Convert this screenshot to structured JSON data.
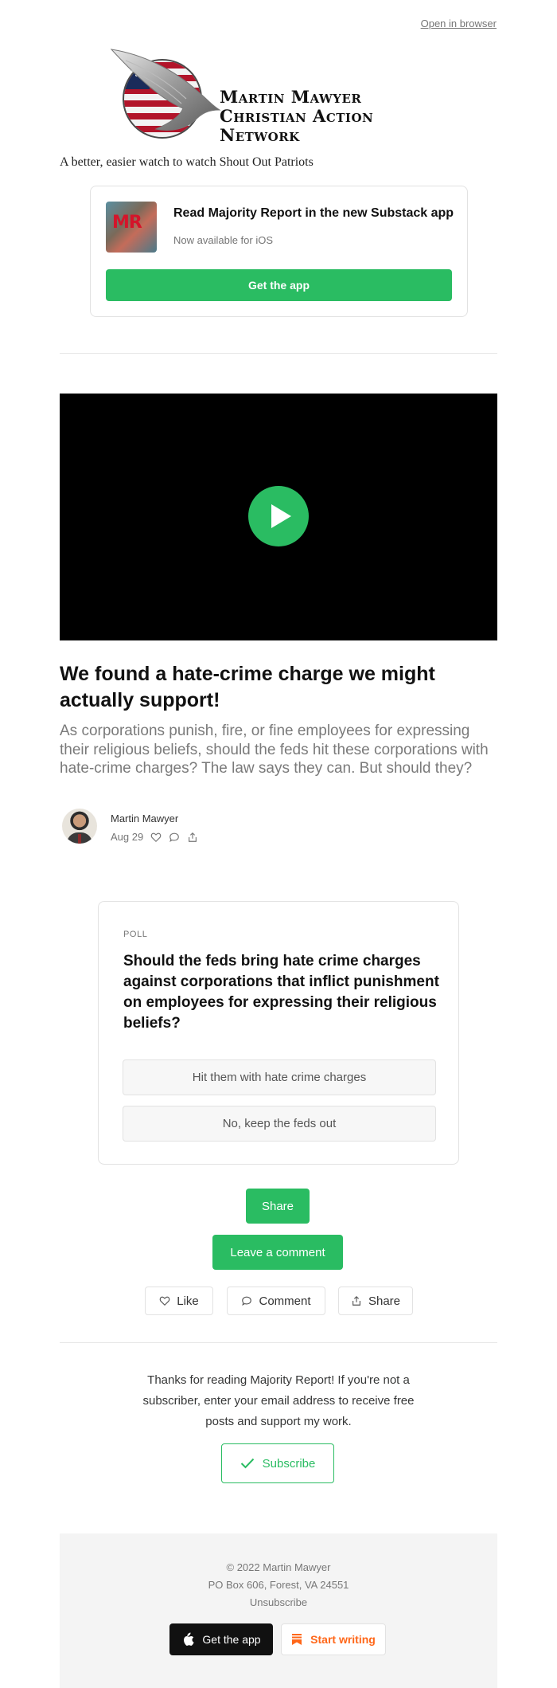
{
  "header": {
    "open_in_browser": "Open in browser",
    "logo_line1": "Martin Mawyer",
    "logo_line2": "Christian Action Network",
    "tagline": "A better, easier watch to watch Shout Out Patriots"
  },
  "app_promo": {
    "thumb_text": "MR",
    "title": "Read Majority Report in the new Substack app",
    "subtitle": "Now available for iOS",
    "button": "Get the app"
  },
  "video": {
    "play_icon": "play-icon"
  },
  "post": {
    "title": "We found a hate-crime charge we might actually support!",
    "subtitle": "As corporations punish, fire, or fine employees for expressing their religious beliefs, should the feds hit these corporations with hate-crime charges? The law says they can. But should they?",
    "author": "Martin Mawyer",
    "date": "Aug 29"
  },
  "poll": {
    "label": "POLL",
    "question": "Should the feds bring hate crime charges against corporations that inflict punishment on employees for expressing their religious beliefs?",
    "options": [
      "Hit them with hate crime charges",
      "No, keep the feds out"
    ]
  },
  "actions": {
    "share": "Share",
    "leave_comment": "Leave a comment",
    "like": "Like",
    "comment": "Comment",
    "share2": "Share"
  },
  "subscribe": {
    "thanks": "Thanks for reading Majority Report! If you're not a subscriber, enter your email address to receive free posts and support my work.",
    "button": "Subscribe"
  },
  "footer": {
    "copyright": "© 2022 Martin Mawyer",
    "address": "PO Box 606, Forest, VA 24551",
    "unsubscribe": "Unsubscribe",
    "get_app": "Get the app",
    "start_writing": "Start writing"
  },
  "colors": {
    "accent": "#2abc62",
    "substack_orange": "#ff6719"
  }
}
